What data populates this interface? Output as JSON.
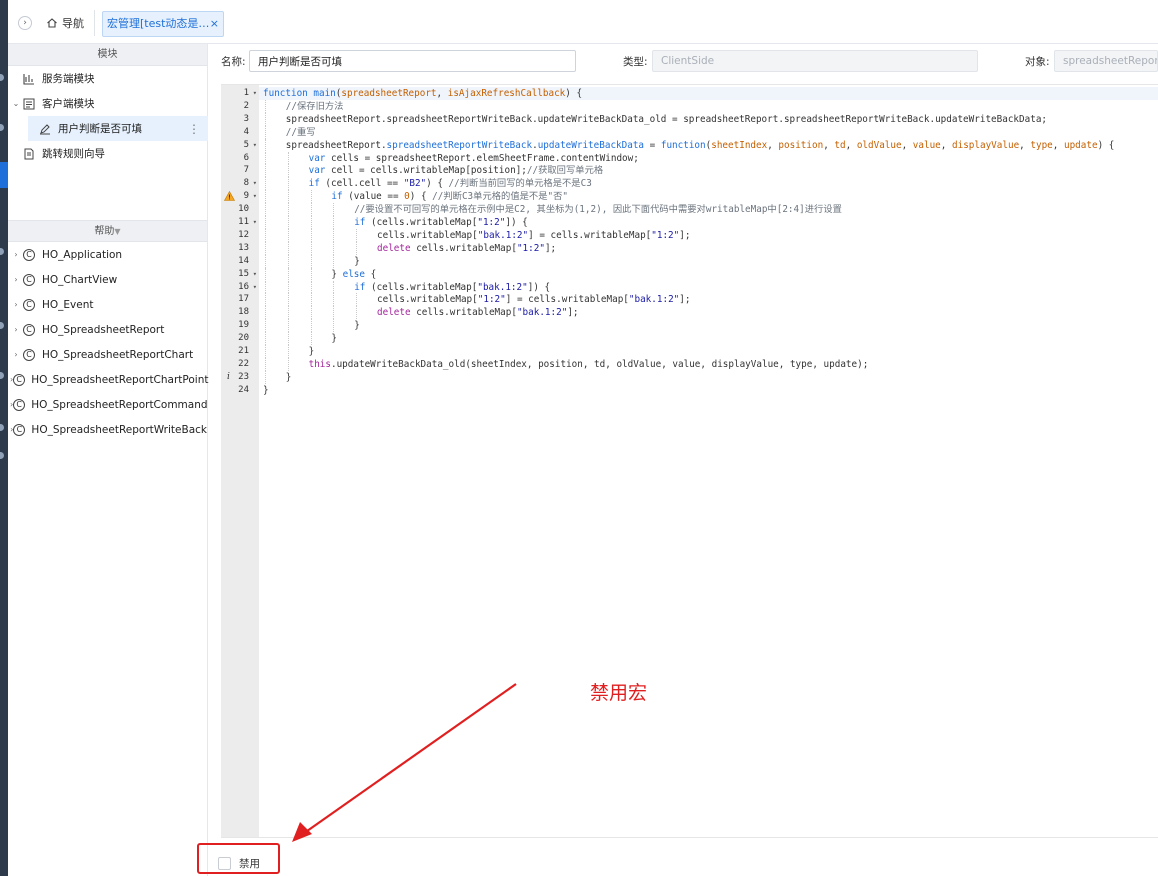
{
  "topbar": {
    "collapse_glyph": "›",
    "nav_label": "导航",
    "tab_label": "宏管理[test动态是否可填]",
    "tab_close": "×"
  },
  "sidebar": {
    "modules_header": "模块",
    "modules": [
      {
        "label": "服务端模块",
        "icon": "server-module-icon"
      },
      {
        "label": "客户端模块",
        "icon": "client-module-icon",
        "expanded": true
      },
      {
        "label": "用户判断是否可填",
        "icon": "macro-edit-icon",
        "selected": true
      },
      {
        "label": "跳转规则向导",
        "icon": "redirect-rule-icon"
      }
    ],
    "more_glyph": "⋮",
    "help_header": "帮助",
    "help_items": [
      "HO_Application",
      "HO_ChartView",
      "HO_Event",
      "HO_SpreadsheetReport",
      "HO_SpreadsheetReportChart",
      "HO_SpreadsheetReportChartPoint",
      "HO_SpreadsheetReportCommand",
      "HO_SpreadsheetReportWriteBack"
    ],
    "class_badge": "C"
  },
  "form": {
    "name_label": "名称:",
    "name_value": "用户判断是否可填",
    "type_label": "类型:",
    "type_value": "ClientSide",
    "object_label": "对象:",
    "object_value": "spreadsheetReport"
  },
  "editor": {
    "line_numbers": [
      "1",
      "2",
      "3",
      "4",
      "5",
      "6",
      "7",
      "8",
      "9",
      "10",
      "11",
      "12",
      "13",
      "14",
      "15",
      "16",
      "17",
      "18",
      "19",
      "20",
      "21",
      "22",
      "23",
      "24"
    ],
    "lines": [
      {
        "indent": 0,
        "parts": [
          [
            "kw",
            "function "
          ],
          [
            "fn",
            "main"
          ],
          [
            "p",
            "("
          ],
          [
            "param",
            "spreadsheetReport"
          ],
          [
            "p",
            ", "
          ],
          [
            "param",
            "isAjaxRefreshCallback"
          ],
          [
            "p",
            ") {"
          ]
        ]
      },
      {
        "indent": 1,
        "parts": [
          [
            "cm",
            "//保存旧方法"
          ]
        ]
      },
      {
        "indent": 1,
        "parts": [
          [
            "p",
            "spreadsheetReport.spreadsheetReportWriteBack.updateWriteBackData_old = spreadsheetReport.spreadsheetReportWriteBack.updateWriteBackData;"
          ]
        ]
      },
      {
        "indent": 1,
        "parts": [
          [
            "cm",
            "//重写"
          ]
        ]
      },
      {
        "indent": 1,
        "parts": [
          [
            "p",
            "spreadsheetReport."
          ],
          [
            "fn",
            "spreadsheetReportWriteBack"
          ],
          [
            "p",
            "."
          ],
          [
            "fn",
            "updateWriteBackData"
          ],
          [
            "p",
            " = "
          ],
          [
            "kw",
            "function"
          ],
          [
            "p",
            "("
          ],
          [
            "param",
            "sheetIndex"
          ],
          [
            "p",
            ", "
          ],
          [
            "param",
            "position"
          ],
          [
            "p",
            ", "
          ],
          [
            "param",
            "td"
          ],
          [
            "p",
            ", "
          ],
          [
            "param",
            "oldValue"
          ],
          [
            "p",
            ", "
          ],
          [
            "param",
            "value"
          ],
          [
            "p",
            ", "
          ],
          [
            "param",
            "displayValue"
          ],
          [
            "p",
            ", "
          ],
          [
            "param",
            "type"
          ],
          [
            "p",
            ", "
          ],
          [
            "param",
            "update"
          ],
          [
            "p",
            ") {"
          ]
        ]
      },
      {
        "indent": 2,
        "parts": [
          [
            "kw",
            "var "
          ],
          [
            "p",
            "cells = spreadsheetReport.elemSheetFrame.contentWindow;"
          ]
        ]
      },
      {
        "indent": 2,
        "parts": [
          [
            "kw",
            "var "
          ],
          [
            "p",
            "cell = cells.writableMap[position];"
          ],
          [
            "cm",
            "//获取回写单元格"
          ]
        ]
      },
      {
        "indent": 2,
        "parts": [
          [
            "kw",
            "if "
          ],
          [
            "p",
            "(cell.cell == "
          ],
          [
            "str",
            "\"B2\""
          ],
          [
            "p",
            ") { "
          ],
          [
            "cm",
            "//判断当前回写的单元格是不是C3"
          ]
        ]
      },
      {
        "indent": 3,
        "parts": [
          [
            "kw",
            "if "
          ],
          [
            "p",
            "(value == "
          ],
          [
            "num",
            "0"
          ],
          [
            "p",
            ") { "
          ],
          [
            "cm",
            "//判断C3单元格的值是不是\"否\""
          ]
        ]
      },
      {
        "indent": 4,
        "parts": [
          [
            "cm",
            "//要设置不可回写的单元格在示例中是C2, 其坐标为(1,2), 因此下面代码中需要对writableMap中[2:4]进行设置"
          ]
        ]
      },
      {
        "indent": 4,
        "parts": [
          [
            "kw",
            "if "
          ],
          [
            "p",
            "(cells.writableMap["
          ],
          [
            "str",
            "\"1:2\""
          ],
          [
            "p",
            "]) {"
          ]
        ]
      },
      {
        "indent": 5,
        "parts": [
          [
            "p",
            "cells.writableMap["
          ],
          [
            "str",
            "\"bak.1:2\""
          ],
          [
            "p",
            "] = cells.writableMap["
          ],
          [
            "str",
            "\"1:2\""
          ],
          [
            "p",
            "];"
          ]
        ]
      },
      {
        "indent": 5,
        "parts": [
          [
            "kw2",
            "delete "
          ],
          [
            "p",
            "cells.writableMap["
          ],
          [
            "str",
            "\"1:2\""
          ],
          [
            "p",
            "];"
          ]
        ]
      },
      {
        "indent": 4,
        "parts": [
          [
            "p",
            "}"
          ]
        ]
      },
      {
        "indent": 3,
        "parts": [
          [
            "p",
            "} "
          ],
          [
            "kw",
            "else "
          ],
          [
            "p",
            "{"
          ]
        ]
      },
      {
        "indent": 4,
        "parts": [
          [
            "kw",
            "if "
          ],
          [
            "p",
            "(cells.writableMap["
          ],
          [
            "str",
            "\"bak.1:2\""
          ],
          [
            "p",
            "]) {"
          ]
        ]
      },
      {
        "indent": 5,
        "parts": [
          [
            "p",
            "cells.writableMap["
          ],
          [
            "str",
            "\"1:2\""
          ],
          [
            "p",
            "] = cells.writableMap["
          ],
          [
            "str",
            "\"bak.1:2\""
          ],
          [
            "p",
            "];"
          ]
        ]
      },
      {
        "indent": 5,
        "parts": [
          [
            "kw2",
            "delete "
          ],
          [
            "p",
            "cells.writableMap["
          ],
          [
            "str",
            "\"bak.1:2\""
          ],
          [
            "p",
            "];"
          ]
        ]
      },
      {
        "indent": 4,
        "parts": [
          [
            "p",
            "}"
          ]
        ]
      },
      {
        "indent": 3,
        "parts": [
          [
            "p",
            "}"
          ]
        ]
      },
      {
        "indent": 2,
        "parts": [
          [
            "p",
            "}"
          ]
        ]
      },
      {
        "indent": 2,
        "parts": [
          [
            "kw2",
            "this"
          ],
          [
            "p",
            ".updateWriteBackData_old(sheetIndex, position, td, oldValue, value, displayValue, type, update);"
          ]
        ]
      },
      {
        "indent": 1,
        "parts": [
          [
            "p",
            "}"
          ]
        ]
      },
      {
        "indent": 0,
        "parts": [
          [
            "p",
            "}"
          ]
        ]
      }
    ],
    "foldable_lines": [
      1,
      5,
      8,
      9,
      11,
      15,
      16
    ],
    "warning_line": 9,
    "info_line": 23,
    "info_glyph": "i"
  },
  "footer": {
    "disable_label": "禁用",
    "disable_checked": false
  },
  "annotation": {
    "text": "禁用宏",
    "color": "#e02020"
  }
}
